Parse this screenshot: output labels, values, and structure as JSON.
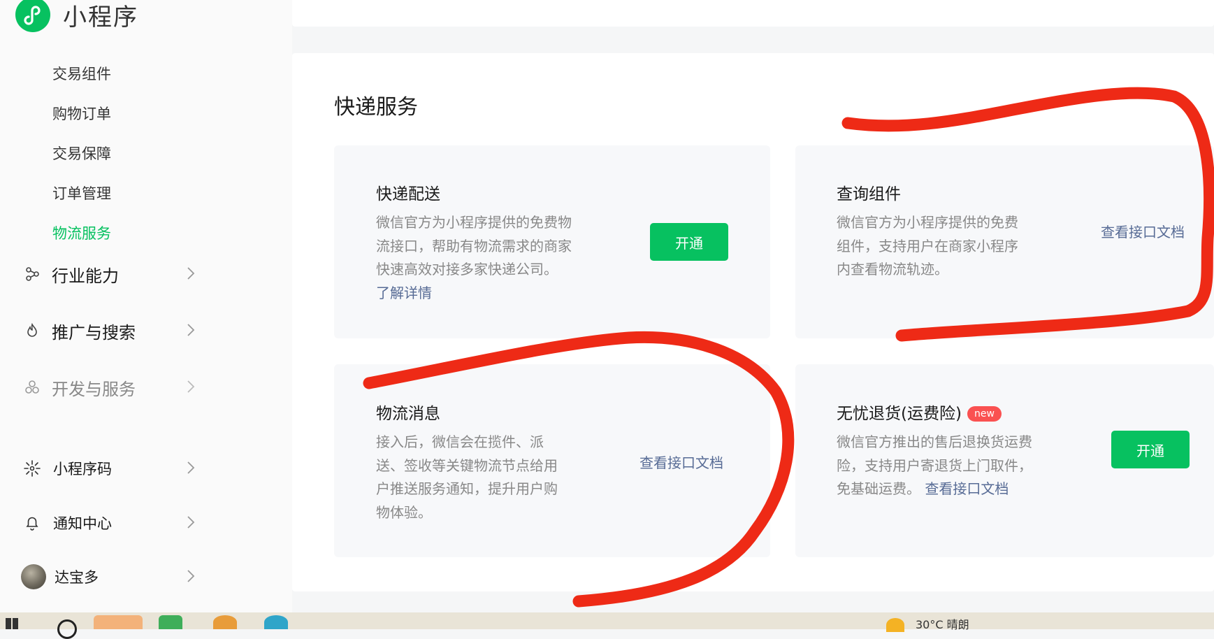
{
  "app": {
    "name": "小程序",
    "accent": "#07c160",
    "link_color": "#576b95",
    "badge_color": "#fa5151"
  },
  "sidebar": {
    "sub_items": [
      {
        "label": "交易组件",
        "active": false
      },
      {
        "label": "购物订单",
        "active": false
      },
      {
        "label": "交易保障",
        "active": false
      },
      {
        "label": "订单管理",
        "active": false
      },
      {
        "label": "物流服务",
        "active": true
      }
    ],
    "groups": [
      {
        "label": "行业能力",
        "icon": "industry-icon"
      },
      {
        "label": "推广与搜索",
        "icon": "flame-icon"
      },
      {
        "label": "开发与服务",
        "icon": "dev-service-icon"
      }
    ],
    "bottom": [
      {
        "label": "小程序码",
        "icon": "qrcode-icon"
      },
      {
        "label": "通知中心",
        "icon": "bell-icon"
      },
      {
        "label": "达宝多",
        "icon": "avatar"
      }
    ]
  },
  "main": {
    "section_title": "快递服务",
    "cards": [
      {
        "title": "快递配送",
        "desc_lines": [
          "微信官方为小程序提供的免费物",
          "流接口，帮助有物流需求的商家",
          "快速高效对接多家快递公司。"
        ],
        "link": "了解详情",
        "button": "开通"
      },
      {
        "title": "查询组件",
        "desc_lines": [
          "微信官方为小程序提供的免费",
          "组件，支持用户在商家小程序",
          "内查看物流轨迹。"
        ],
        "doc_link": "查看接口文档"
      },
      {
        "title": "物流消息",
        "desc_lines": [
          "接入后，微信会在揽件、派",
          "送、签收等关键物流节点给用",
          "户推送服务通知，提升用户购",
          "物体验。"
        ],
        "doc_link": "查看接口文档"
      },
      {
        "title": "无忧退货(运费险)",
        "badge": "new",
        "desc_lines": [
          "微信官方推出的售后退换货运费",
          "险，支持用户寄退货上门取件，",
          "免基础运费。"
        ],
        "inline_link": "查看接口文档",
        "button": "开通"
      }
    ]
  },
  "taskbar": {
    "weather": "30°C 晴朗"
  },
  "annotations": {
    "scribble_color": "#ee2a16"
  }
}
